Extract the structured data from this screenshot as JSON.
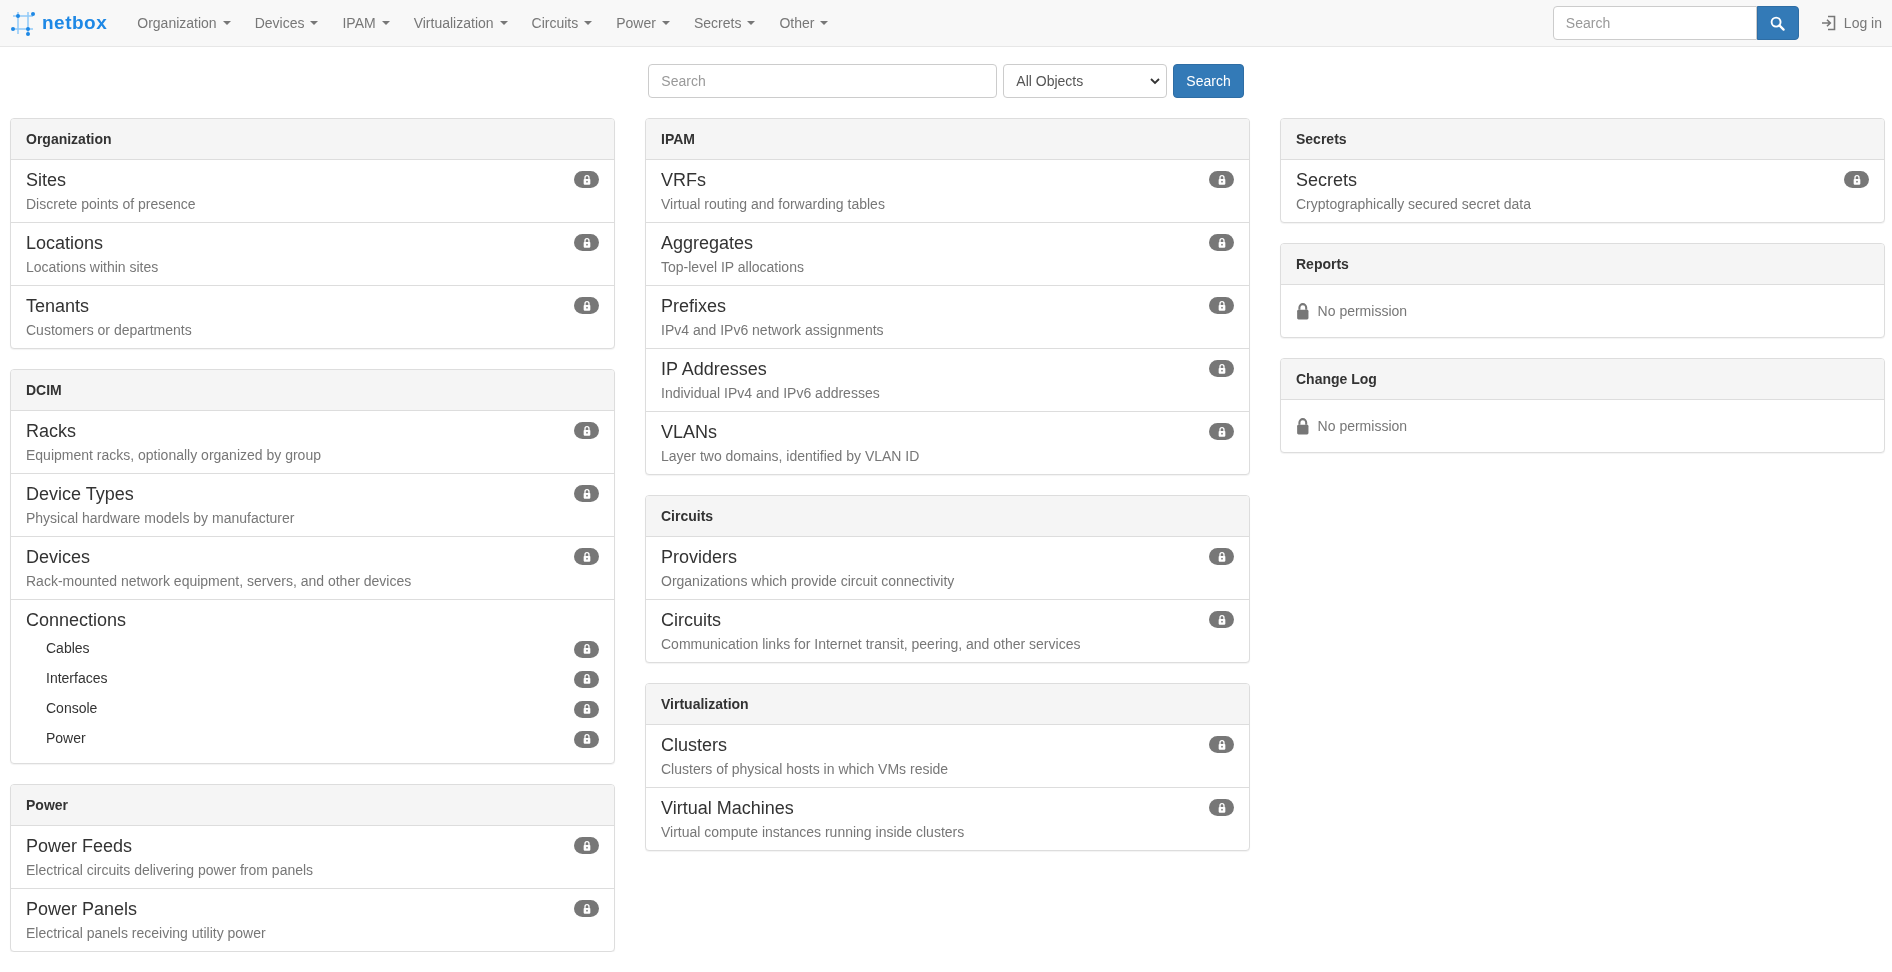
{
  "navbar": {
    "brand": "netbox",
    "menus": [
      {
        "label": "Organization"
      },
      {
        "label": "Devices"
      },
      {
        "label": "IPAM"
      },
      {
        "label": "Virtualization"
      },
      {
        "label": "Circuits"
      },
      {
        "label": "Power"
      },
      {
        "label": "Secrets"
      },
      {
        "label": "Other"
      }
    ],
    "search": {
      "placeholder": "Search"
    },
    "login": "Log in"
  },
  "search_bar": {
    "placeholder": "Search",
    "scope": "All Objects",
    "button": "Search"
  },
  "columns": [
    [
      {
        "title": "Organization",
        "items": [
          {
            "kind": "link",
            "title": "Sites",
            "description": "Discrete points of presence"
          },
          {
            "kind": "link",
            "title": "Locations",
            "description": "Locations within sites"
          },
          {
            "kind": "link",
            "title": "Tenants",
            "description": "Customers or departments"
          }
        ]
      },
      {
        "title": "DCIM",
        "items": [
          {
            "kind": "link",
            "title": "Racks",
            "description": "Equipment racks, optionally organized by group"
          },
          {
            "kind": "link",
            "title": "Device Types",
            "description": "Physical hardware models by manufacturer"
          },
          {
            "kind": "link",
            "title": "Devices",
            "description": "Rack-mounted network equipment, servers, and other devices"
          },
          {
            "kind": "group",
            "title": "Connections",
            "children": [
              {
                "title": "Cables"
              },
              {
                "title": "Interfaces"
              },
              {
                "title": "Console"
              },
              {
                "title": "Power"
              }
            ]
          }
        ]
      },
      {
        "title": "Power",
        "items": [
          {
            "kind": "link",
            "title": "Power Feeds",
            "description": "Electrical circuits delivering power from panels"
          },
          {
            "kind": "link",
            "title": "Power Panels",
            "description": "Electrical panels receiving utility power"
          }
        ]
      }
    ],
    [
      {
        "title": "IPAM",
        "items": [
          {
            "kind": "link",
            "title": "VRFs",
            "description": "Virtual routing and forwarding tables"
          },
          {
            "kind": "link",
            "title": "Aggregates",
            "description": "Top-level IP allocations"
          },
          {
            "kind": "link",
            "title": "Prefixes",
            "description": "IPv4 and IPv6 network assignments"
          },
          {
            "kind": "link",
            "title": "IP Addresses",
            "description": "Individual IPv4 and IPv6 addresses"
          },
          {
            "kind": "link",
            "title": "VLANs",
            "description": "Layer two domains, identified by VLAN ID"
          }
        ]
      },
      {
        "title": "Circuits",
        "items": [
          {
            "kind": "link",
            "title": "Providers",
            "description": "Organizations which provide circuit connectivity"
          },
          {
            "kind": "link",
            "title": "Circuits",
            "description": "Communication links for Internet transit, peering, and other services"
          }
        ]
      },
      {
        "title": "Virtualization",
        "items": [
          {
            "kind": "link",
            "title": "Clusters",
            "description": "Clusters of physical hosts in which VMs reside"
          },
          {
            "kind": "link",
            "title": "Virtual Machines",
            "description": "Virtual compute instances running inside clusters"
          }
        ]
      }
    ],
    [
      {
        "title": "Secrets",
        "items": [
          {
            "kind": "link",
            "title": "Secrets",
            "description": "Cryptographically secured secret data"
          }
        ]
      },
      {
        "title": "Reports",
        "items": [
          {
            "kind": "notice",
            "text": "No permission"
          }
        ]
      },
      {
        "title": "Change Log",
        "items": [
          {
            "kind": "notice",
            "text": "No permission"
          }
        ]
      }
    ]
  ]
}
